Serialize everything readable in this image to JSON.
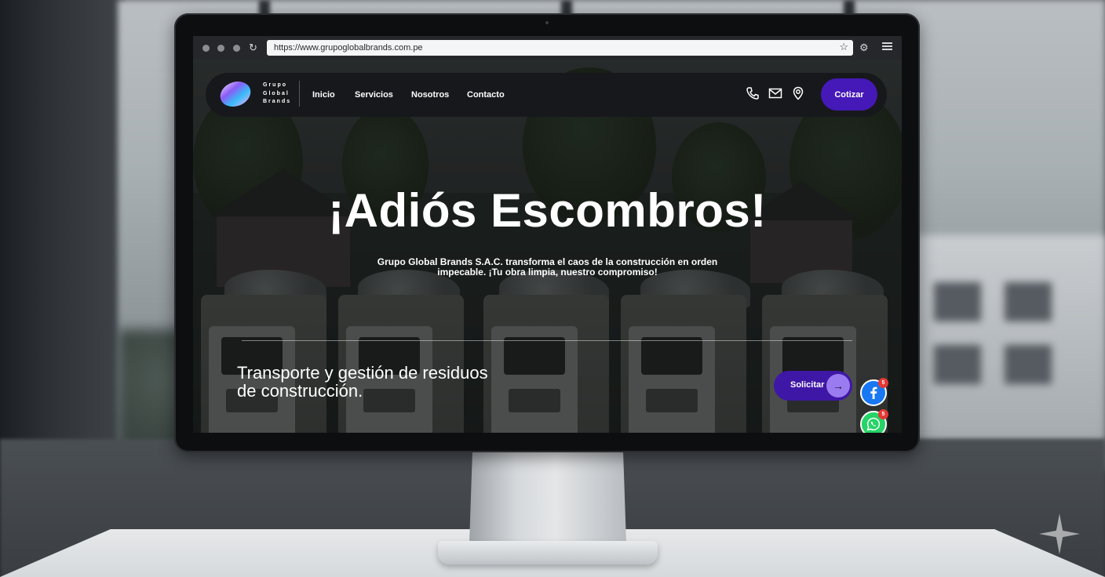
{
  "browser": {
    "url": "https://www.grupoglobalbrands.com.pe",
    "icons": [
      "reload-icon",
      "bookmark-star-icon",
      "extension-icon",
      "menu-icon"
    ]
  },
  "site": {
    "logo": {
      "line1": "Grupo",
      "line2": "Global",
      "line3": "Brands"
    },
    "nav": {
      "items": [
        {
          "label": "Inicio"
        },
        {
          "label": "Servicios"
        },
        {
          "label": "Nosotros"
        },
        {
          "label": "Contacto"
        }
      ],
      "icons": [
        "phone-icon",
        "mail-icon",
        "location-pin-icon"
      ],
      "cta_label": "Cotizar"
    },
    "hero": {
      "title": "¡Adiós Escombros!",
      "subtitle": "Grupo Global Brands S.A.C. transforma el caos de la construcción en orden impecable. ¡Tu obra limpia, nuestro compromiso!",
      "tagline_line1": "Transporte y gestión de residuos",
      "tagline_line2": "de construcción.",
      "request_label": "Solicitar",
      "request_arrow": "→"
    },
    "social": {
      "facebook_badge": "5",
      "whatsapp_badge": "5"
    }
  },
  "colors": {
    "brand_purple": "#4518b8",
    "facebook_blue": "#1877f2",
    "whatsapp_green": "#25d366",
    "badge_red": "#e53935"
  }
}
